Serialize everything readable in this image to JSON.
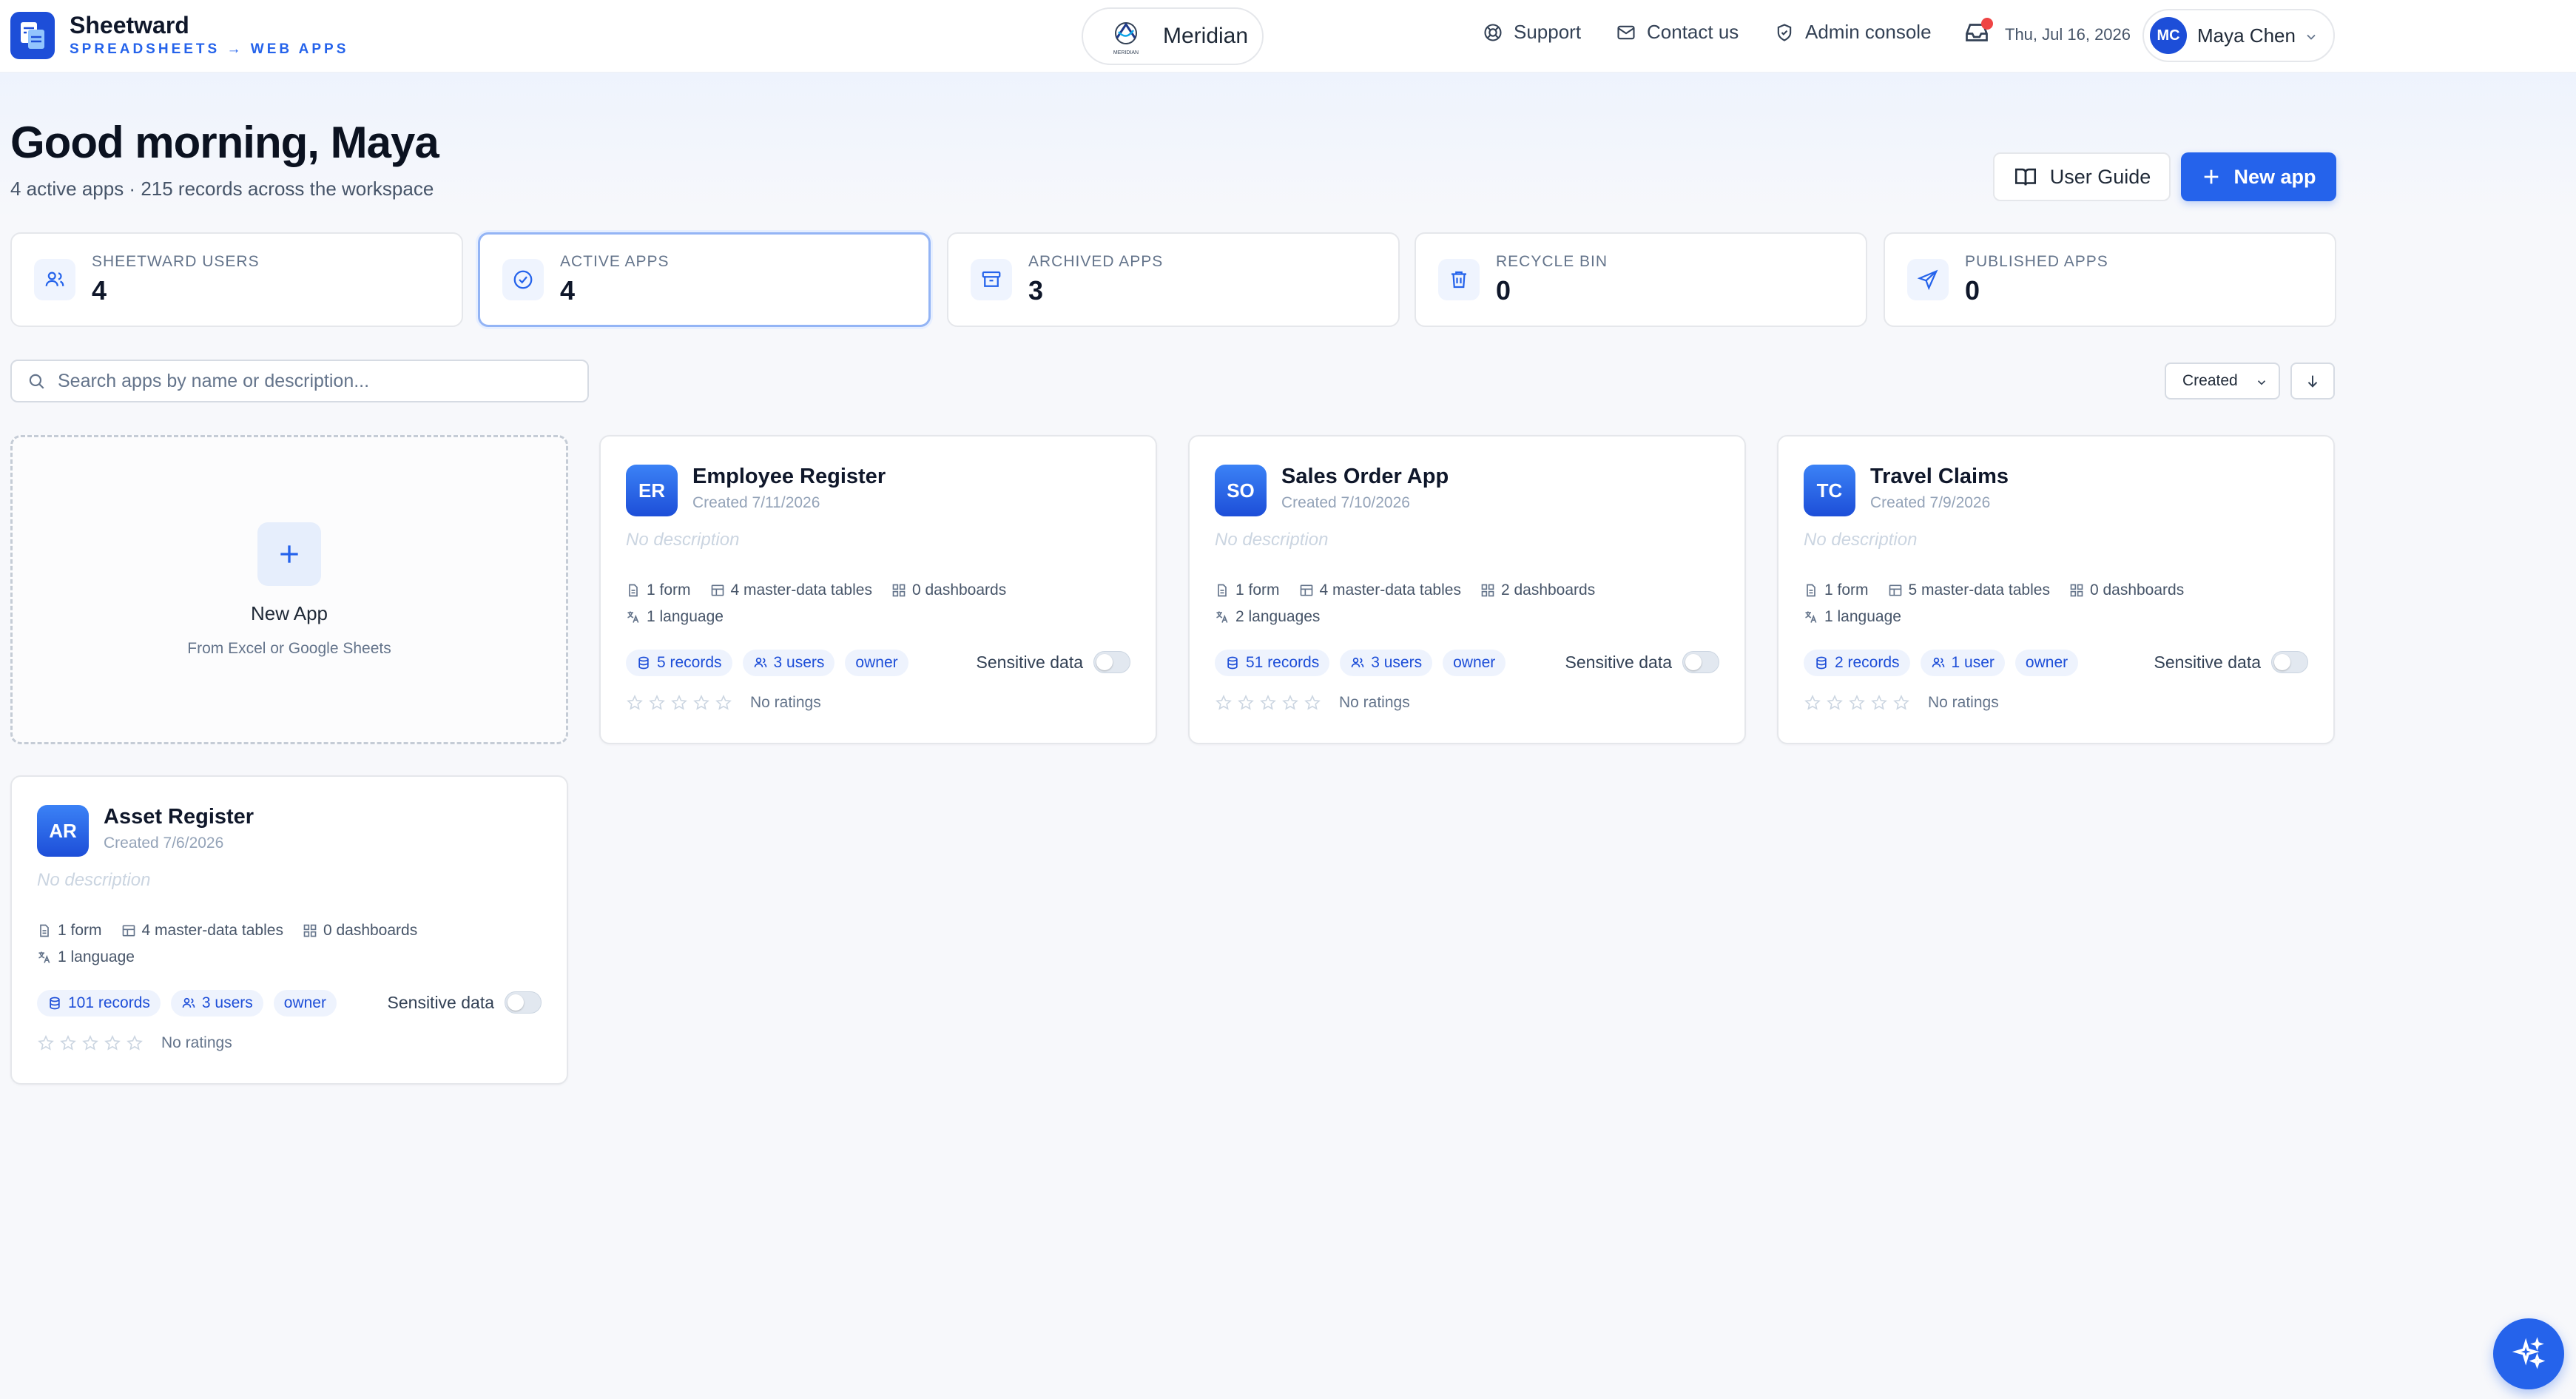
{
  "brand": {
    "name": "Sheetward",
    "tagline": "SPREADSHEETS → WEB APPS"
  },
  "org": {
    "name": "Meridian",
    "logo_text": "MERIDIAN"
  },
  "nav": {
    "support": "Support",
    "contact": "Contact us",
    "admin": "Admin console"
  },
  "header": {
    "date": "Thu, Jul 16, 2026"
  },
  "user": {
    "initials": "MC",
    "name": "Maya Chen"
  },
  "greeting": {
    "title": "Good morning, Maya",
    "subtitle": "4 active apps · 215 records across the workspace"
  },
  "actions": {
    "guide_label": "User Guide",
    "new_label": "New app"
  },
  "stats": [
    {
      "label": "SHEETWARD USERS",
      "value": "4",
      "icon": "users-icon"
    },
    {
      "label": "ACTIVE APPS",
      "value": "4",
      "icon": "check-circle-icon"
    },
    {
      "label": "ARCHIVED APPS",
      "value": "3",
      "icon": "archive-icon"
    },
    {
      "label": "RECYCLE BIN",
      "value": "0",
      "icon": "trash-icon"
    },
    {
      "label": "PUBLISHED APPS",
      "value": "0",
      "icon": "send-icon"
    }
  ],
  "search": {
    "placeholder": "Search apps by name or description..."
  },
  "sort": {
    "selected": "Created"
  },
  "new_app_card": {
    "title": "New App",
    "subtitle": "From Excel or Google Sheets"
  },
  "apps": [
    {
      "initials": "ER",
      "name": "Employee Register",
      "created": "Created 7/11/2026",
      "description": "No description",
      "forms": "1 form",
      "tables": "4 master-data tables",
      "dashboards": "0 dashboards",
      "languages": "1 language",
      "records": "5 records",
      "users": "3 users",
      "role": "owner",
      "sensitive_label": "Sensitive data",
      "ratings": "No ratings"
    },
    {
      "initials": "SO",
      "name": "Sales Order App",
      "created": "Created 7/10/2026",
      "description": "No description",
      "forms": "1 form",
      "tables": "4 master-data tables",
      "dashboards": "2 dashboards",
      "languages": "2 languages",
      "records": "51 records",
      "users": "3 users",
      "role": "owner",
      "sensitive_label": "Sensitive data",
      "ratings": "No ratings"
    },
    {
      "initials": "TC",
      "name": "Travel Claims",
      "created": "Created 7/9/2026",
      "description": "No description",
      "forms": "1 form",
      "tables": "5 master-data tables",
      "dashboards": "0 dashboards",
      "languages": "1 language",
      "records": "2 records",
      "users": "1 user",
      "role": "owner",
      "sensitive_label": "Sensitive data",
      "ratings": "No ratings"
    },
    {
      "initials": "AR",
      "name": "Asset Register",
      "created": "Created 7/6/2026",
      "description": "No description",
      "forms": "1 form",
      "tables": "4 master-data tables",
      "dashboards": "0 dashboards",
      "languages": "1 language",
      "records": "101 records",
      "users": "3 users",
      "role": "owner",
      "sensitive_label": "Sensitive data",
      "ratings": "No ratings"
    }
  ],
  "colors": {
    "accent": "#2563eb",
    "notification": "#ef4444"
  }
}
